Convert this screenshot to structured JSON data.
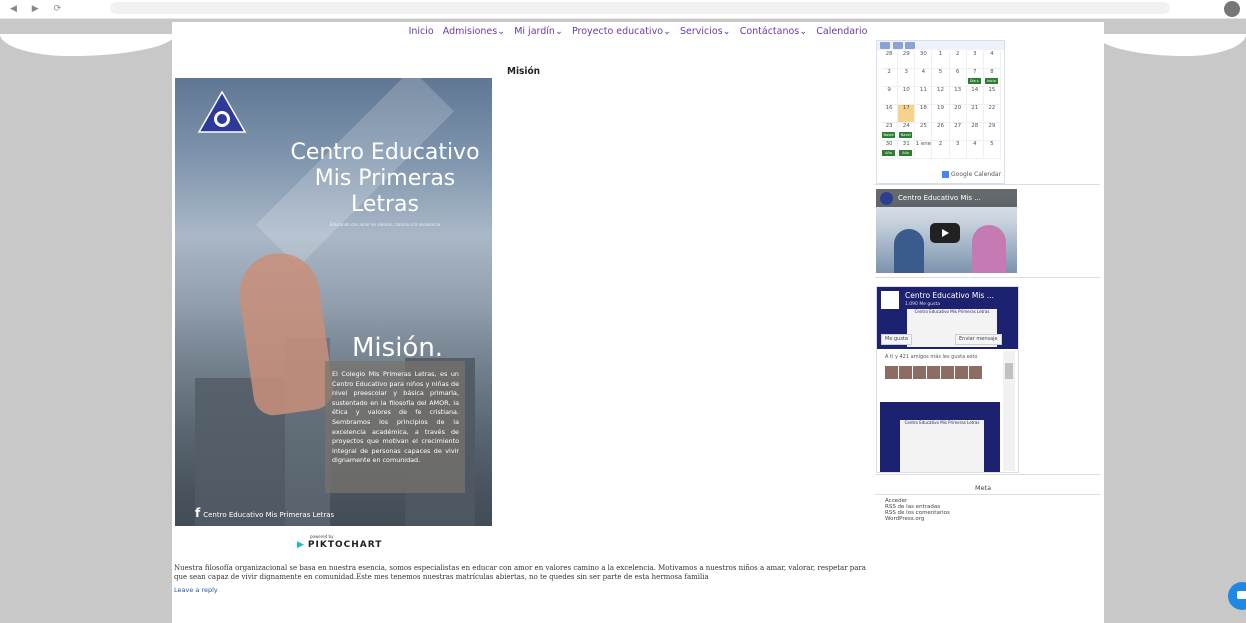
{
  "nav": {
    "items": [
      "Inicio",
      "Admisiones⌄",
      "Mi jardín⌄",
      "Proyecto educativo⌄",
      "Servicios⌄",
      "Contáctanos⌄",
      "Calendario"
    ]
  },
  "post": {
    "title": "Misión",
    "poster": {
      "title": "Centro Educativo Mis Primeras Letras",
      "subtitle": "Educando con amor en valores, camino a la excelencia",
      "section": "Misión.",
      "text": "El Colegio Mis Primeras Letras, es un Centro Educativo para niños y niñas de nivel preescolar y básica primaria, sustentado en la filosofía del AMOR, la ética y valores de fe cristiana. Sembramos los principios de la excelencia académica, a través de proyectos que motivan el crecimiento integral de personas capaces de vivir dignamente en comunidad.",
      "facebook_label": "Centro Educativo Mis Primeras Letras",
      "fb_icon": "f"
    },
    "powered_by": "powered by",
    "piktochart": "PIKTOCHART",
    "body": "Nuestra filosofía organizacional se basa en nuestra esencia, somos especialistas en educar con amor en valores camino a la excelencia. Motivamos a nuestros niños a amar, valorar, respetar para que sean capaz de vivir dignamente en comunidad.Este mes tenemos nuestras matrículas abiertas, no te quedes sin ser parte de esta hermosa familia",
    "reply": "Leave a reply"
  },
  "calendar": {
    "weeks": [
      [
        "28",
        "29",
        "30",
        "1",
        "2",
        "3",
        "4"
      ],
      [
        "2",
        "3",
        "4",
        "5",
        "6",
        "7",
        "8"
      ],
      [
        "9",
        "10",
        "11",
        "12",
        "13",
        "14",
        "15"
      ],
      [
        "16",
        "17",
        "18",
        "19",
        "20",
        "21",
        "22"
      ],
      [
        "23",
        "24",
        "25",
        "26",
        "27",
        "28",
        "29"
      ],
      [
        "30",
        "31",
        "1 ene",
        "2",
        "3",
        "4",
        "5"
      ]
    ],
    "events": {
      "w1d5": "Día s",
      "w1d6": "Inicio",
      "w4d0": "Navid",
      "w4d1": "Navid",
      "w5d0": "Año",
      "w5d1": "Año"
    },
    "google_label": "Google Calendar"
  },
  "video": {
    "title": "Centro Educativo Mis ..."
  },
  "facebook": {
    "page_name": "Centro Educativo Mis ...",
    "likes": "1.090 Me gusta",
    "cover_text": "Centro Educativo Mis Primeras Letras",
    "like_btn": "Me gusta",
    "message_btn": "Enviar mensaje",
    "friends_text": "A ti y 421 amigos más les gusta esto",
    "post_text": "Centro Educativo Mis Primeras Letras"
  },
  "meta": {
    "title": "Meta",
    "links": [
      "Acceder",
      "RSS de las entradas",
      "RSS de los comentarios",
      "WordPress.org"
    ]
  }
}
